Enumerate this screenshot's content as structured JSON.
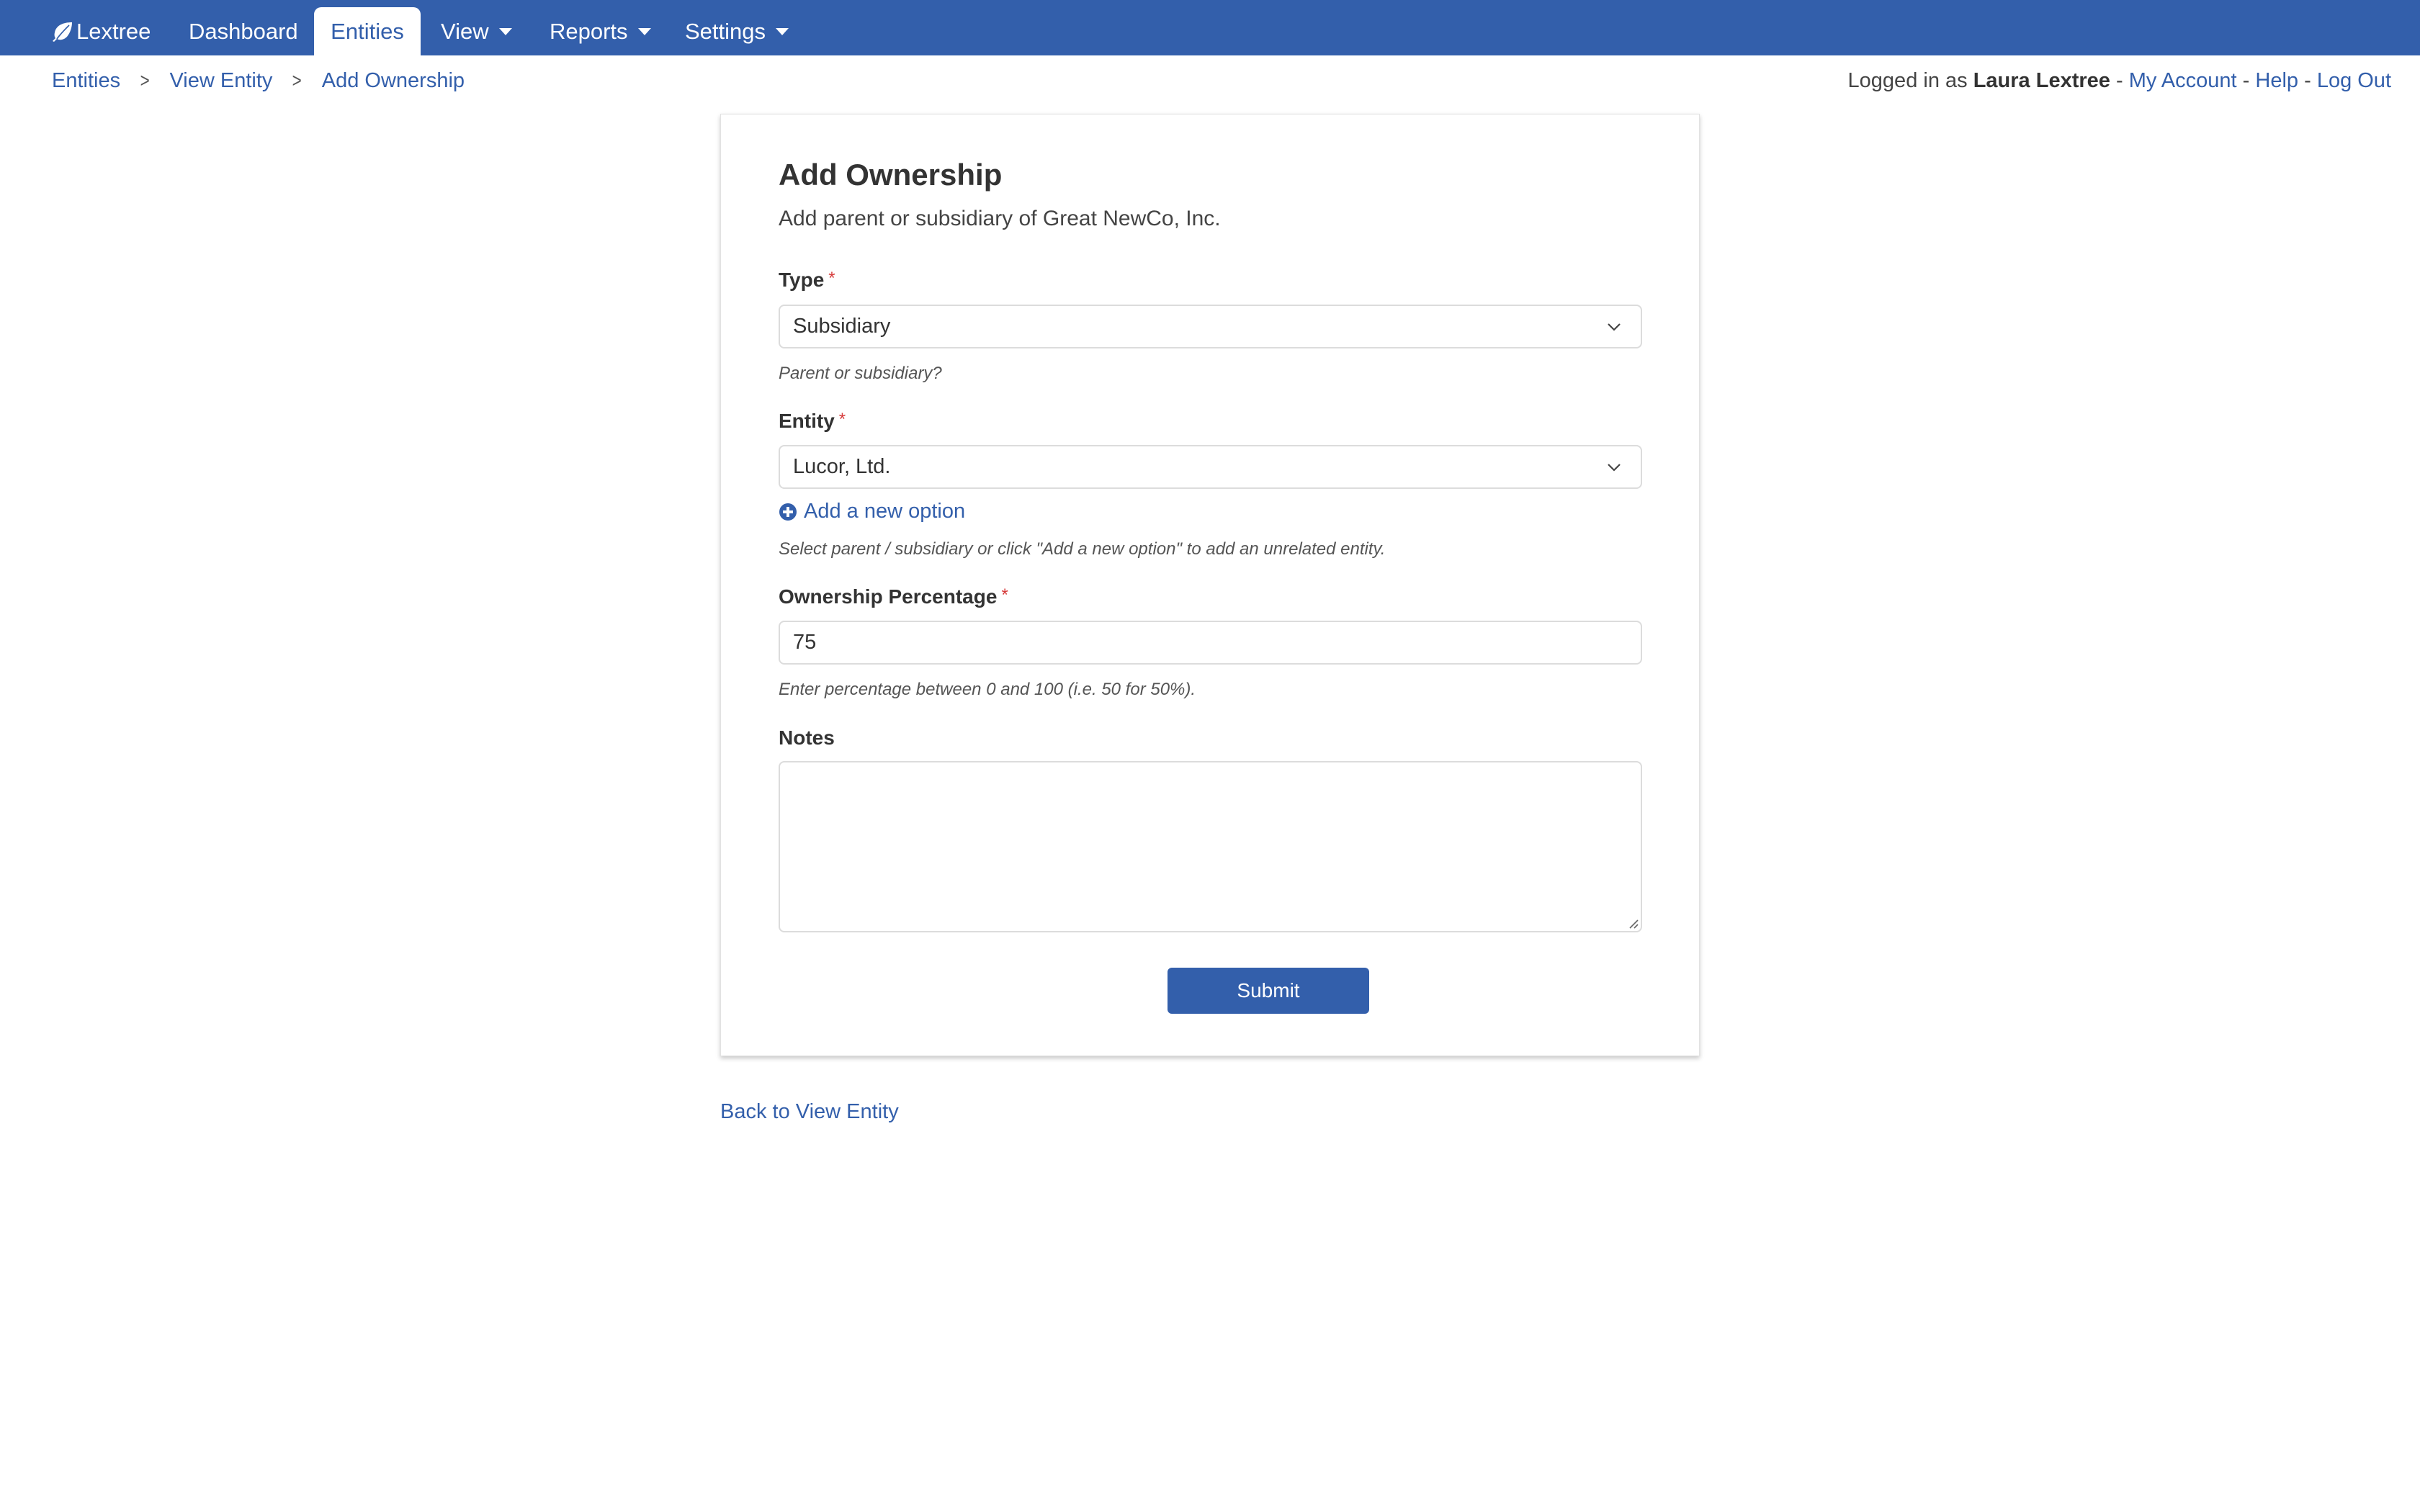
{
  "nav": {
    "brand": "Lextree",
    "brand_icon": "leaf-icon",
    "items": [
      {
        "label": "Dashboard",
        "active": false,
        "dropdown": false
      },
      {
        "label": "Entities",
        "active": true,
        "dropdown": false
      },
      {
        "label": "View",
        "active": false,
        "dropdown": true
      },
      {
        "label": "Reports",
        "active": false,
        "dropdown": true
      },
      {
        "label": "Settings",
        "active": false,
        "dropdown": true
      }
    ]
  },
  "breadcrumb": [
    {
      "label": "Entities"
    },
    {
      "label": "View Entity"
    },
    {
      "label": "Add Ownership"
    }
  ],
  "account": {
    "prefix": "Logged in as ",
    "user": "Laura Lextree",
    "separator": " - ",
    "links": [
      "My Account",
      "Help",
      "Log Out"
    ]
  },
  "form": {
    "title": "Add Ownership",
    "subtitle": "Add parent or subsidiary of Great NewCo, Inc.",
    "required_marker": "*",
    "type": {
      "label": "Type",
      "value": "Subsidiary",
      "help": "Parent or subsidiary?"
    },
    "entity": {
      "label": "Entity",
      "value": "Lucor, Ltd.",
      "add_option": "Add a new option",
      "help": "Select parent / subsidiary or click \"Add a new option\" to add an unrelated entity."
    },
    "ownership": {
      "label": "Ownership Percentage",
      "value": "75",
      "help": "Enter percentage between 0 and 100 (i.e. 50 for 50%)."
    },
    "notes": {
      "label": "Notes",
      "value": ""
    },
    "submit": "Submit"
  },
  "back_link": "Back to View Entity",
  "colors": {
    "brand": "#335fab",
    "required": "#d63a3a"
  }
}
